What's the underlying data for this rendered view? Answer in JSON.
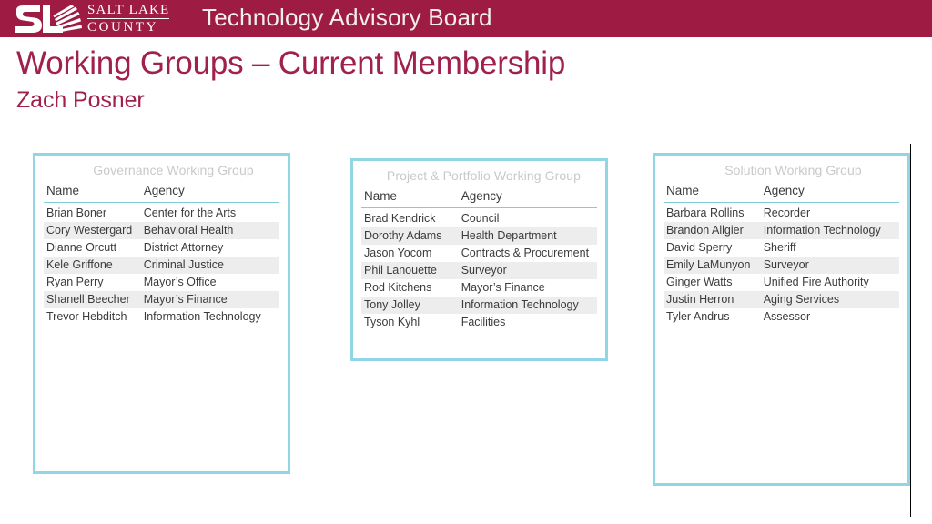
{
  "header": {
    "organization_line1": "SALT LAKE",
    "organization_line2": "COUNTY",
    "logo_monogram": "SL",
    "title": "Technology Advisory Board",
    "bar_color": "#9e1b43"
  },
  "slide": {
    "title": "Working Groups – Current Membership",
    "subtitle": "Zach Posner",
    "title_color": "#a0214a",
    "card_border_color": "#92d5e6",
    "header_rule_color": "#7fcdd8",
    "row_stripe_color": "#ededed",
    "group_heading_color": "#c9c9c9"
  },
  "groups": [
    {
      "heading": "Governance Working Group",
      "columns": [
        "Name",
        "Agency"
      ],
      "rows": [
        {
          "name": "Brian Boner",
          "agency": "Center for the Arts"
        },
        {
          "name": "Cory Westergard",
          "agency": "Behavioral Health"
        },
        {
          "name": "Dianne Orcutt",
          "agency": "District Attorney"
        },
        {
          "name": "Kele Griffone",
          "agency": "Criminal Justice"
        },
        {
          "name": "Ryan Perry",
          "agency": "Mayor’s Office"
        },
        {
          "name": "Shanell Beecher",
          "agency": "Mayor’s Finance"
        },
        {
          "name": "Trevor Hebditch",
          "agency": "Information Technology"
        }
      ]
    },
    {
      "heading": "Project  & Portfolio Working Group",
      "columns": [
        "Name",
        "Agency"
      ],
      "rows": [
        {
          "name": "Brad Kendrick",
          "agency": "Council"
        },
        {
          "name": "Dorothy Adams",
          "agency": "Health Department"
        },
        {
          "name": "Jason Yocom",
          "agency": "Contracts & Procurement"
        },
        {
          "name": "Phil Lanouette",
          "agency": "Surveyor"
        },
        {
          "name": "Rod Kitchens",
          "agency": "Mayor’s Finance"
        },
        {
          "name": "Tony Jolley",
          "agency": "Information Technology"
        },
        {
          "name": "Tyson Kyhl",
          "agency": "Facilities"
        }
      ]
    },
    {
      "heading": "Solution Working Group",
      "columns": [
        "Name",
        "Agency"
      ],
      "rows": [
        {
          "name": "Barbara Rollins",
          "agency": "Recorder"
        },
        {
          "name": "Brandon Allgier",
          "agency": "Information Technology"
        },
        {
          "name": "David Sperry",
          "agency": "Sheriff"
        },
        {
          "name": "Emily LaMunyon",
          "agency": "Surveyor"
        },
        {
          "name": "Ginger Watts",
          "agency": "Unified Fire Authority"
        },
        {
          "name": "Justin Herron",
          "agency": "Aging Services"
        },
        {
          "name": "Tyler Andrus",
          "agency": "Assessor"
        }
      ]
    }
  ]
}
